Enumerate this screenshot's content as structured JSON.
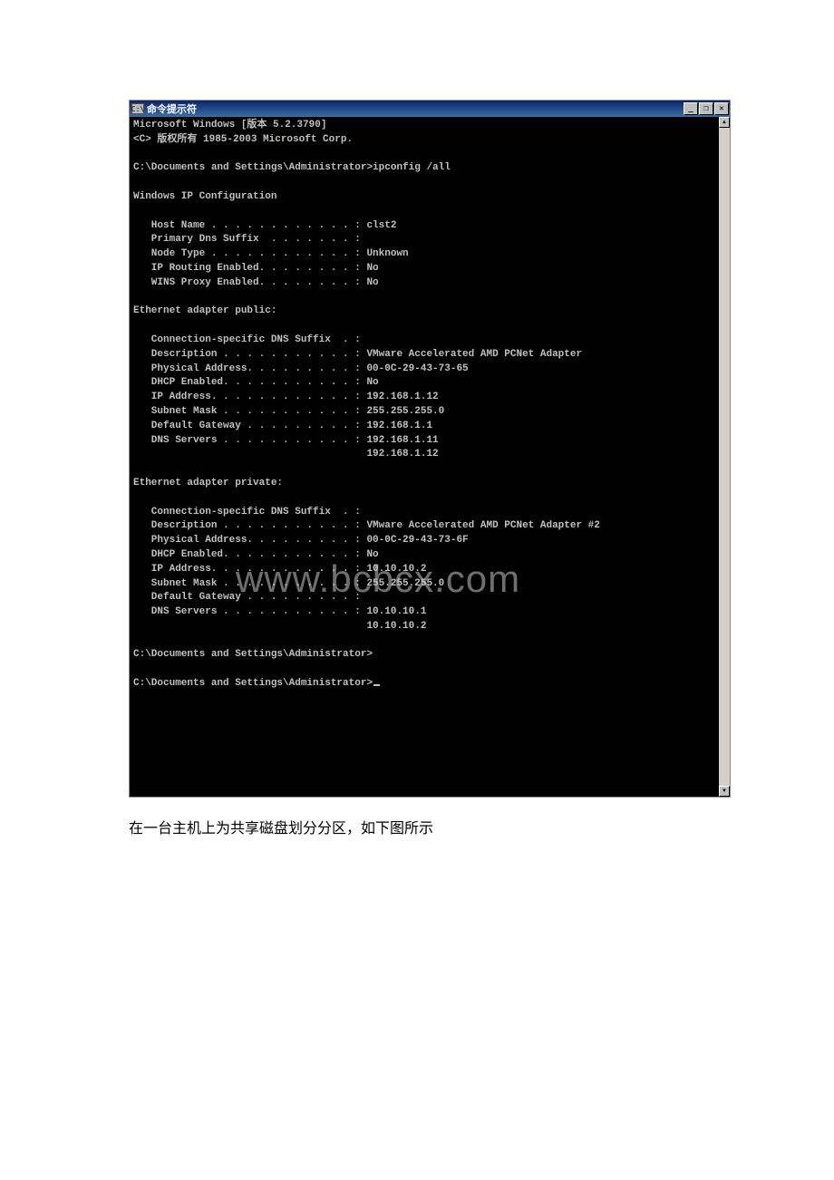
{
  "window": {
    "title": "命令提示符",
    "icon_label": "C:\\"
  },
  "controls": {
    "min": "_",
    "max": "❐",
    "close": "✕"
  },
  "scroll": {
    "up": "▲",
    "down": "▼"
  },
  "terminal": {
    "line1": "Microsoft Windows [版本 5.2.3790]",
    "line2": "<C> 版权所有 1985-2003 Microsoft Corp.",
    "blank1": "",
    "prompt1": "C:\\Documents and Settings\\Administrator>ipconfig /all",
    "blank2": "",
    "header": "Windows IP Configuration",
    "blank3": "",
    "cfg_lines": [
      "   Host Name . . . . . . . . . . . . : clst2",
      "   Primary Dns Suffix  . . . . . . . :",
      "   Node Type . . . . . . . . . . . . : Unknown",
      "   IP Routing Enabled. . . . . . . . : No",
      "   WINS Proxy Enabled. . . . . . . . : No"
    ],
    "blank4": "",
    "adapter1_header": "Ethernet adapter public:",
    "blank5": "",
    "adapter1_lines": [
      "   Connection-specific DNS Suffix  . :",
      "   Description . . . . . . . . . . . : VMware Accelerated AMD PCNet Adapter",
      "   Physical Address. . . . . . . . . : 00-0C-29-43-73-65",
      "   DHCP Enabled. . . . . . . . . . . : No",
      "   IP Address. . . . . . . . . . . . : 192.168.1.12",
      "   Subnet Mask . . . . . . . . . . . : 255.255.255.0",
      "   Default Gateway . . . . . . . . . : 192.168.1.1",
      "   DNS Servers . . . . . . . . . . . : 192.168.1.11",
      "                                       192.168.1.12"
    ],
    "blank6": "",
    "adapter2_header": "Ethernet adapter private:",
    "blank7": "",
    "adapter2_lines": [
      "   Connection-specific DNS Suffix  . :",
      "   Description . . . . . . . . . . . : VMware Accelerated AMD PCNet Adapter #2",
      "   Physical Address. . . . . . . . . : 00-0C-29-43-73-6F",
      "   DHCP Enabled. . . . . . . . . . . : No",
      "   IP Address. . . . . . . . . . . . : 10.10.10.2",
      "   Subnet Mask . . . . . . . . . . . : 255.255.255.0",
      "   Default Gateway . . . . . . . . . :",
      "   DNS Servers . . . . . . . . . . . : 10.10.10.1",
      "                                       10.10.10.2"
    ],
    "blank8": "",
    "prompt2": "C:\\Documents and Settings\\Administrator>",
    "blank9": "",
    "prompt3": "C:\\Documents and Settings\\Administrator>"
  },
  "watermark": "www.bcbcx.com",
  "caption": "在一台主机上为共享磁盘划分分区，如下图所示"
}
